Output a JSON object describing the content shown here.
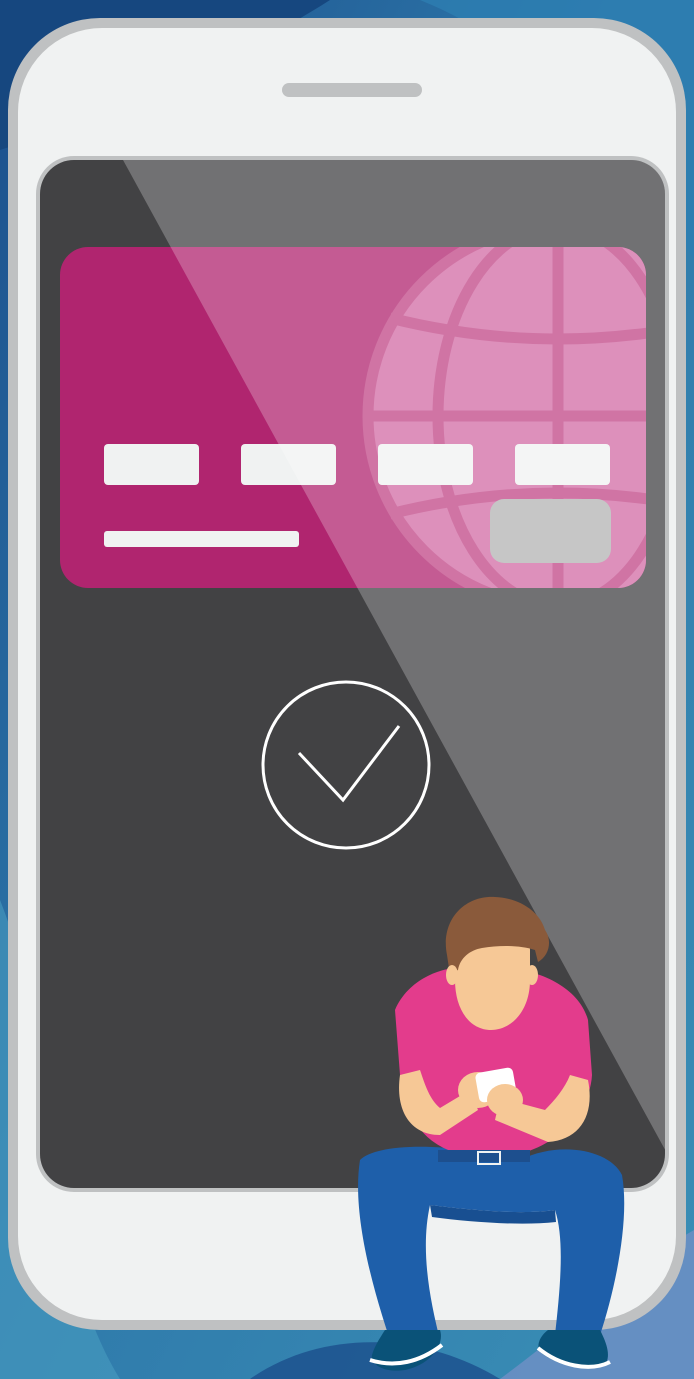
{
  "illustration": {
    "subject": "mobile-payment-success",
    "icons": {
      "card": "credit-card-icon",
      "globe": "globe-icon",
      "status": "checkmark-circle-icon",
      "person": "person-using-phone"
    },
    "colors": {
      "background_dark": "#1b4f8c",
      "background_light": "#3a8fb6",
      "phone_body": "#f0f2f2",
      "phone_border": "#bfc1c2",
      "screen": "#424244",
      "screen_shine": "#6e6e6f",
      "card": "#b0256f",
      "card_globe": "#d26ba5",
      "card_fields": "#f0f2f2",
      "card_chip": "#b3b3b3",
      "check": "#ffffff",
      "shirt": "#e33c8c",
      "jeans": "#1e5faa",
      "hair": "#8a5a3b",
      "skin": "#f6c896",
      "shoes": "#0a5278"
    }
  }
}
